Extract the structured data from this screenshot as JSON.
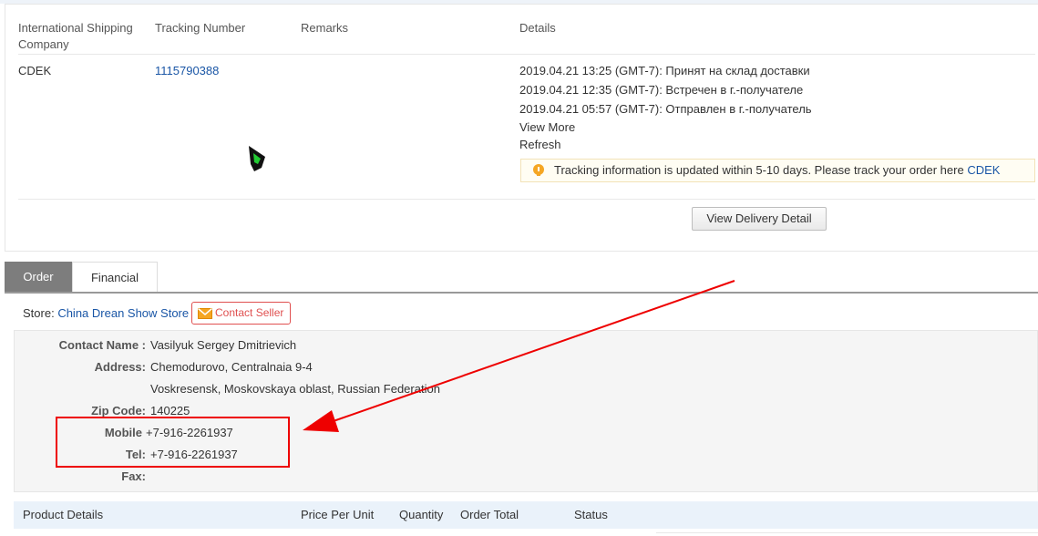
{
  "shipping": {
    "headers": {
      "company": "International Shipping Company",
      "tracking": "Tracking Number",
      "remarks": "Remarks",
      "details": "Details"
    },
    "row": {
      "company": "CDEK",
      "tracking_number": "1115790388",
      "details": [
        "2019.04.21 13:25 (GMT-7): Принят на склад доставки",
        "2019.04.21 12:35 (GMT-7): Встречен в г.-получателе",
        "2019.04.21 05:57 (GMT-7): Отправлен в г.-получатель"
      ],
      "view_more": "View More",
      "refresh": "Refresh"
    },
    "notice_text": "Tracking information is updated within 5-10 days. Please track your order here",
    "notice_link": "CDEK",
    "view_delivery_button": "View Delivery Detail"
  },
  "tabs": [
    "Order",
    "Financial"
  ],
  "store": {
    "label": "Store:",
    "name": "China Drean Show Store",
    "contact_button": "Contact Seller"
  },
  "address": {
    "contact_name_label": "Contact Name :",
    "contact_name": "Vasilyuk Sergey Dmitrievich",
    "address_label": "Address:",
    "address_line1": "Chemodurovo, Centralnaia 9-4",
    "address_line2": "Voskresensk, Moskovskaya oblast, Russian Federation",
    "zip_label": "Zip Code:",
    "zip": "140225",
    "mobile_label": "Mobile",
    "mobile": "+7-916-2261937",
    "tel_label": "Tel:",
    "tel": "+7-916-2261937",
    "fax_label": "Fax:",
    "fax": ""
  },
  "product_table": {
    "headers": [
      "Product Details",
      "Price Per Unit",
      "Quantity",
      "Order Total",
      "Status"
    ]
  },
  "colors": {
    "link": "#1a56a6",
    "annotation": "#ee0000",
    "tab_active": "#7d7d7d",
    "contact_seller": "#e05050"
  }
}
